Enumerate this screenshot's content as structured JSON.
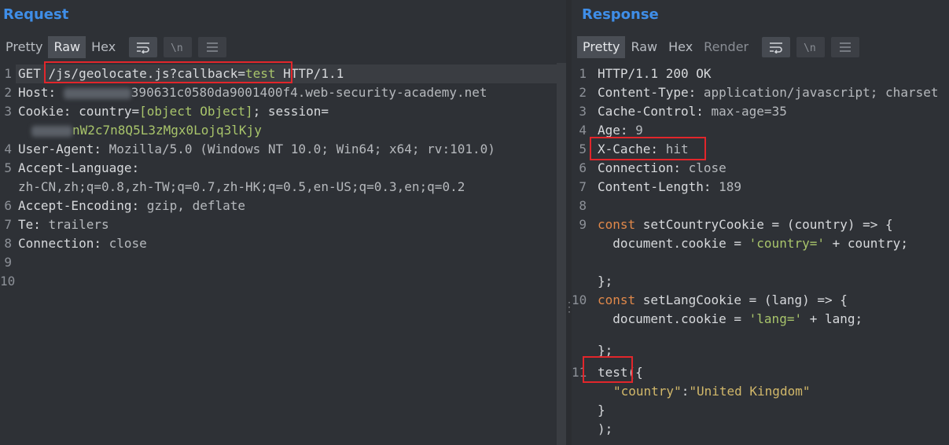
{
  "request": {
    "title": "Request",
    "tabs": [
      {
        "label": "Pretty",
        "active": false
      },
      {
        "label": "Raw",
        "active": true
      },
      {
        "label": "Hex",
        "active": false
      }
    ],
    "line_numbers": [
      "1",
      "2",
      "3",
      "",
      "4",
      "5",
      "",
      "6",
      "7",
      "8",
      "9",
      "10"
    ],
    "lines": {
      "l1_method": "GET ",
      "l1_path": "/js/geolocate.js?callback=",
      "l1_cb": "test",
      "l1_proto": " HTTP/1.1",
      "l2_key": "Host: ",
      "l2_val": "390631c0580da9001400f4.web-security-academy.net",
      "l3_key": "Cookie: ",
      "l3_ck": "country",
      "l3_eq": "=",
      "l3_obj": "[object Object]",
      "l3_semi": "; ",
      "l3_sess": "session",
      "l3_eq2": "=",
      "l3b_val": "nW2c7n8Q5L3zMgx0Lojq3lKjy",
      "l4_key": "User-Agent: ",
      "l4_val": "Mozilla/5.0 (Windows NT 10.0; Win64; x64; rv:101.0)",
      "l5_key": "Accept-Language: ",
      "l5b_val": "zh-CN,zh;q=0.8,zh-TW;q=0.7,zh-HK;q=0.5,en-US;q=0.3,en;q=0.2",
      "l6_key": "Accept-Encoding: ",
      "l6_val": "gzip, deflate",
      "l7_key": "Te: ",
      "l7_val": "trailers",
      "l8_key": "Connection: ",
      "l8_val": "close"
    }
  },
  "response": {
    "title": "Response",
    "tabs": [
      {
        "label": "Pretty",
        "active": true
      },
      {
        "label": "Raw",
        "active": false
      },
      {
        "label": "Hex",
        "active": false
      },
      {
        "label": "Render",
        "active": false
      }
    ],
    "line_numbers": [
      "1",
      "2",
      "3",
      "4",
      "5",
      "6",
      "7",
      "8",
      "9",
      "10",
      "11"
    ],
    "lines": {
      "r1": "HTTP/1.1 200 OK",
      "r2_key": "Content-Type: ",
      "r2_val": "application/javascript; charset",
      "r3_key": "Cache-Control: ",
      "r3_val": "max-age=35",
      "r4_key": "Age: ",
      "r4_val": "9",
      "r5_key": "X-Cache: ",
      "r5_val": "hit",
      "r6_key": "Connection: ",
      "r6_val": "close",
      "r7_key": "Content-Length: ",
      "r7_val": "189",
      "r9_const": "const ",
      "r9_rest": "setCountryCookie = (country) => {",
      "r9b_a": "  document.cookie = ",
      "r9b_str": "'country='",
      "r9b_b": " + country;",
      "r9c": "};",
      "r10_const": "const ",
      "r10_rest": "setLangCookie = (lang) => {",
      "r10b_a": "  document.cookie = ",
      "r10b_str": "'lang='",
      "r10b_b": " + lang;",
      "r10c": "};",
      "r11_fn": "test",
      "r11_rest": "({",
      "r11b_key": "\"country\"",
      "r11b_colon": ":",
      "r11b_val": "\"United Kingdom\"",
      "r11c": "}",
      "r11d": ");"
    }
  }
}
